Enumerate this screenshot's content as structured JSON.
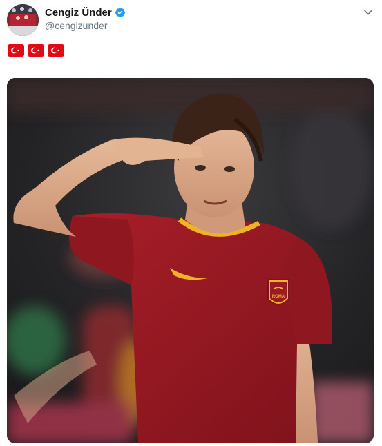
{
  "tweet": {
    "author": {
      "display_name": "Cengiz Ünder",
      "handle": "@cengizunder",
      "verified": true
    },
    "body": {
      "flags": [
        "turkey-flag",
        "turkey-flag",
        "turkey-flag"
      ]
    },
    "media": {
      "type": "photo",
      "jersey_badge_text": "ROMA"
    }
  },
  "colors": {
    "text_primary": "#14171a",
    "text_secondary": "#657786",
    "verified_blue": "#1da1f2",
    "turkey_red": "#e30a17",
    "roma_jersey": "#9b1b24",
    "roma_gold": "#f0b323"
  },
  "icons": {
    "verified": "verified-badge-icon",
    "caret": "chevron-down-icon"
  }
}
